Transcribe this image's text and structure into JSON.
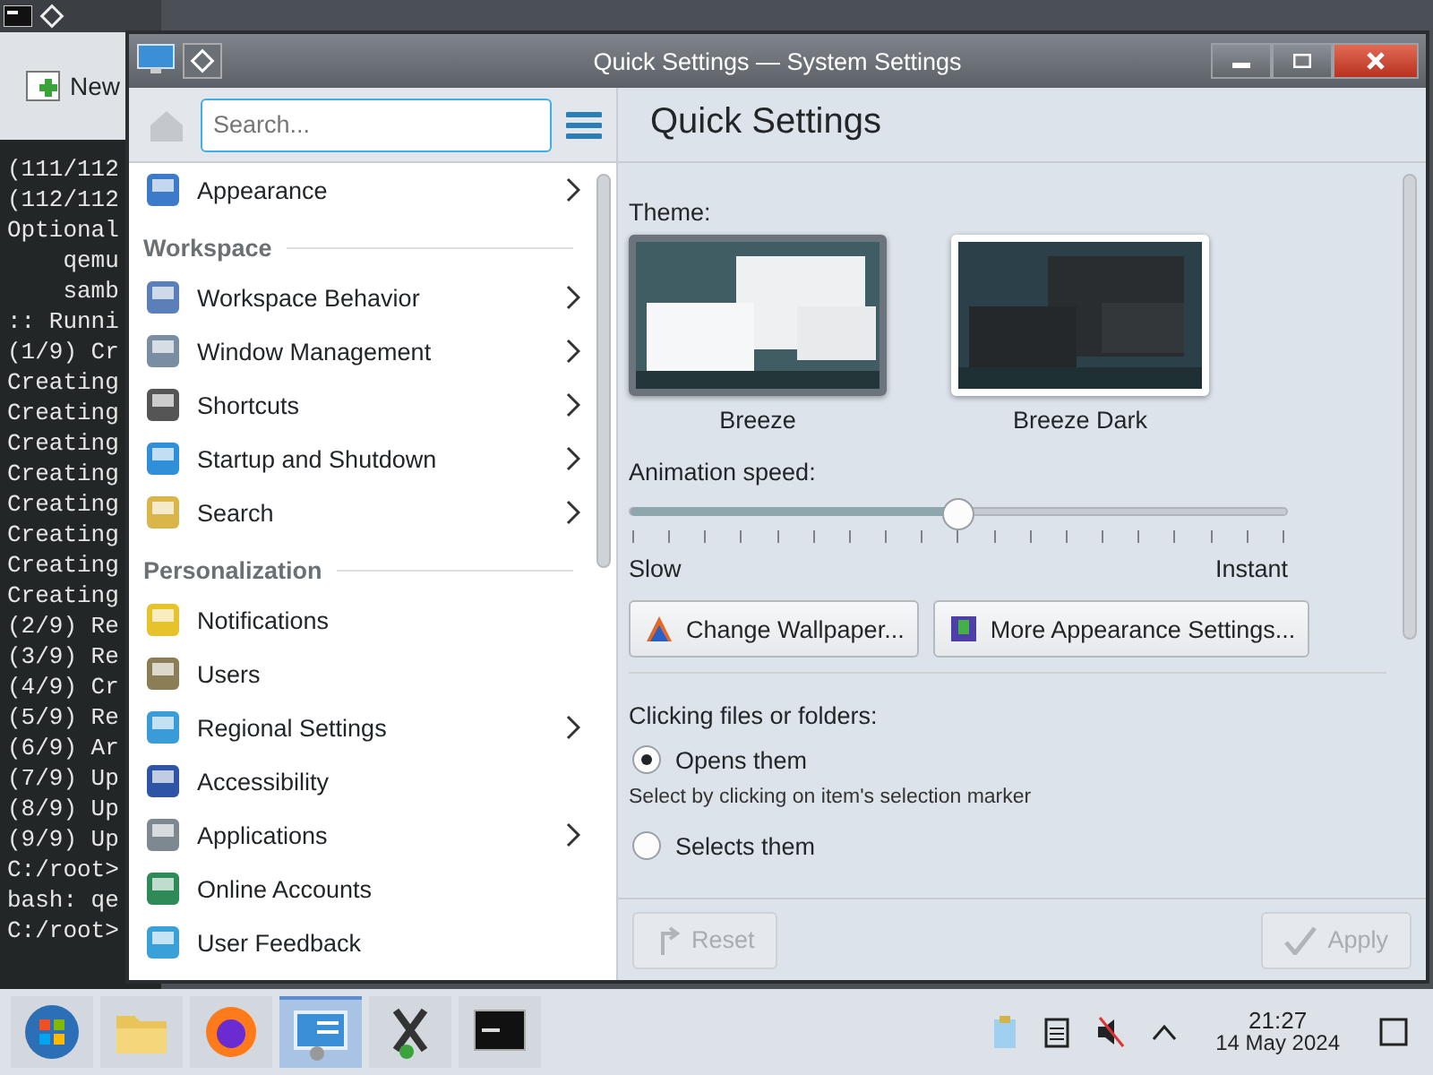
{
  "terminal": {
    "toolbar_button": "New",
    "lines": [
      "(111/112",
      "(112/112",
      "Optional",
      "    qemu",
      "    samb",
      ":: Runni",
      "(1/9) Cr",
      "Creating",
      "Creating",
      "Creating",
      "Creating",
      "Creating",
      "Creating",
      "Creating",
      "Creating",
      "(2/9) Re",
      "(3/9) Re",
      "(4/9) Cr",
      "(5/9) Re",
      "(6/9) Ar",
      "(7/9) Up",
      "(8/9) Up",
      "(9/9) Up",
      "C:/root>",
      "bash: qe",
      "C:/root>"
    ]
  },
  "window": {
    "title": "Quick Settings — System Settings"
  },
  "sidebar": {
    "search": {
      "placeholder": "Search..."
    },
    "groups": [
      {
        "items": [
          {
            "label": "Appearance",
            "expandable": true
          }
        ]
      },
      {
        "heading": "Workspace",
        "items": [
          {
            "label": "Workspace Behavior",
            "expandable": true
          },
          {
            "label": "Window Management",
            "expandable": true
          },
          {
            "label": "Shortcuts",
            "expandable": true
          },
          {
            "label": "Startup and Shutdown",
            "expandable": true
          },
          {
            "label": "Search",
            "expandable": true
          }
        ]
      },
      {
        "heading": "Personalization",
        "items": [
          {
            "label": "Notifications",
            "expandable": false
          },
          {
            "label": "Users",
            "expandable": false
          },
          {
            "label": "Regional Settings",
            "expandable": true
          },
          {
            "label": "Accessibility",
            "expandable": false
          },
          {
            "label": "Applications",
            "expandable": true
          },
          {
            "label": "Online Accounts",
            "expandable": false
          },
          {
            "label": "User Feedback",
            "expandable": false
          }
        ]
      }
    ]
  },
  "page": {
    "title": "Quick Settings",
    "theme_label": "Theme:",
    "themes": [
      {
        "name": "Breeze",
        "kind": "light",
        "selected": true
      },
      {
        "name": "Breeze Dark",
        "kind": "dark",
        "selected": false
      }
    ],
    "animation": {
      "label": "Animation speed:",
      "level": 0.5,
      "min_label": "Slow",
      "max_label": "Instant"
    },
    "buttons": [
      "Change Wallpaper...",
      "More Appearance Settings..."
    ],
    "clicking": {
      "label": "Clicking files or folders:",
      "options": [
        {
          "label": "Opens them",
          "selected": true,
          "hint": "Select by clicking on item's selection marker"
        },
        {
          "label": "Selects them",
          "selected": false
        }
      ]
    },
    "footer": [
      {
        "label": "Reset",
        "kind": "reset",
        "disabled": true
      },
      {
        "label": "Apply",
        "kind": "apply",
        "disabled": true
      }
    ]
  },
  "taskbar": {
    "items": [
      {
        "kind": "start",
        "selected": false
      },
      {
        "kind": "files",
        "selected": false
      },
      {
        "kind": "browser",
        "selected": false
      },
      {
        "kind": "settings",
        "selected": true
      },
      {
        "kind": "xapp",
        "selected": false
      },
      {
        "kind": "terminal",
        "selected": false
      }
    ],
    "clock": {
      "time": "21:27",
      "date": "14 May 2024"
    }
  }
}
